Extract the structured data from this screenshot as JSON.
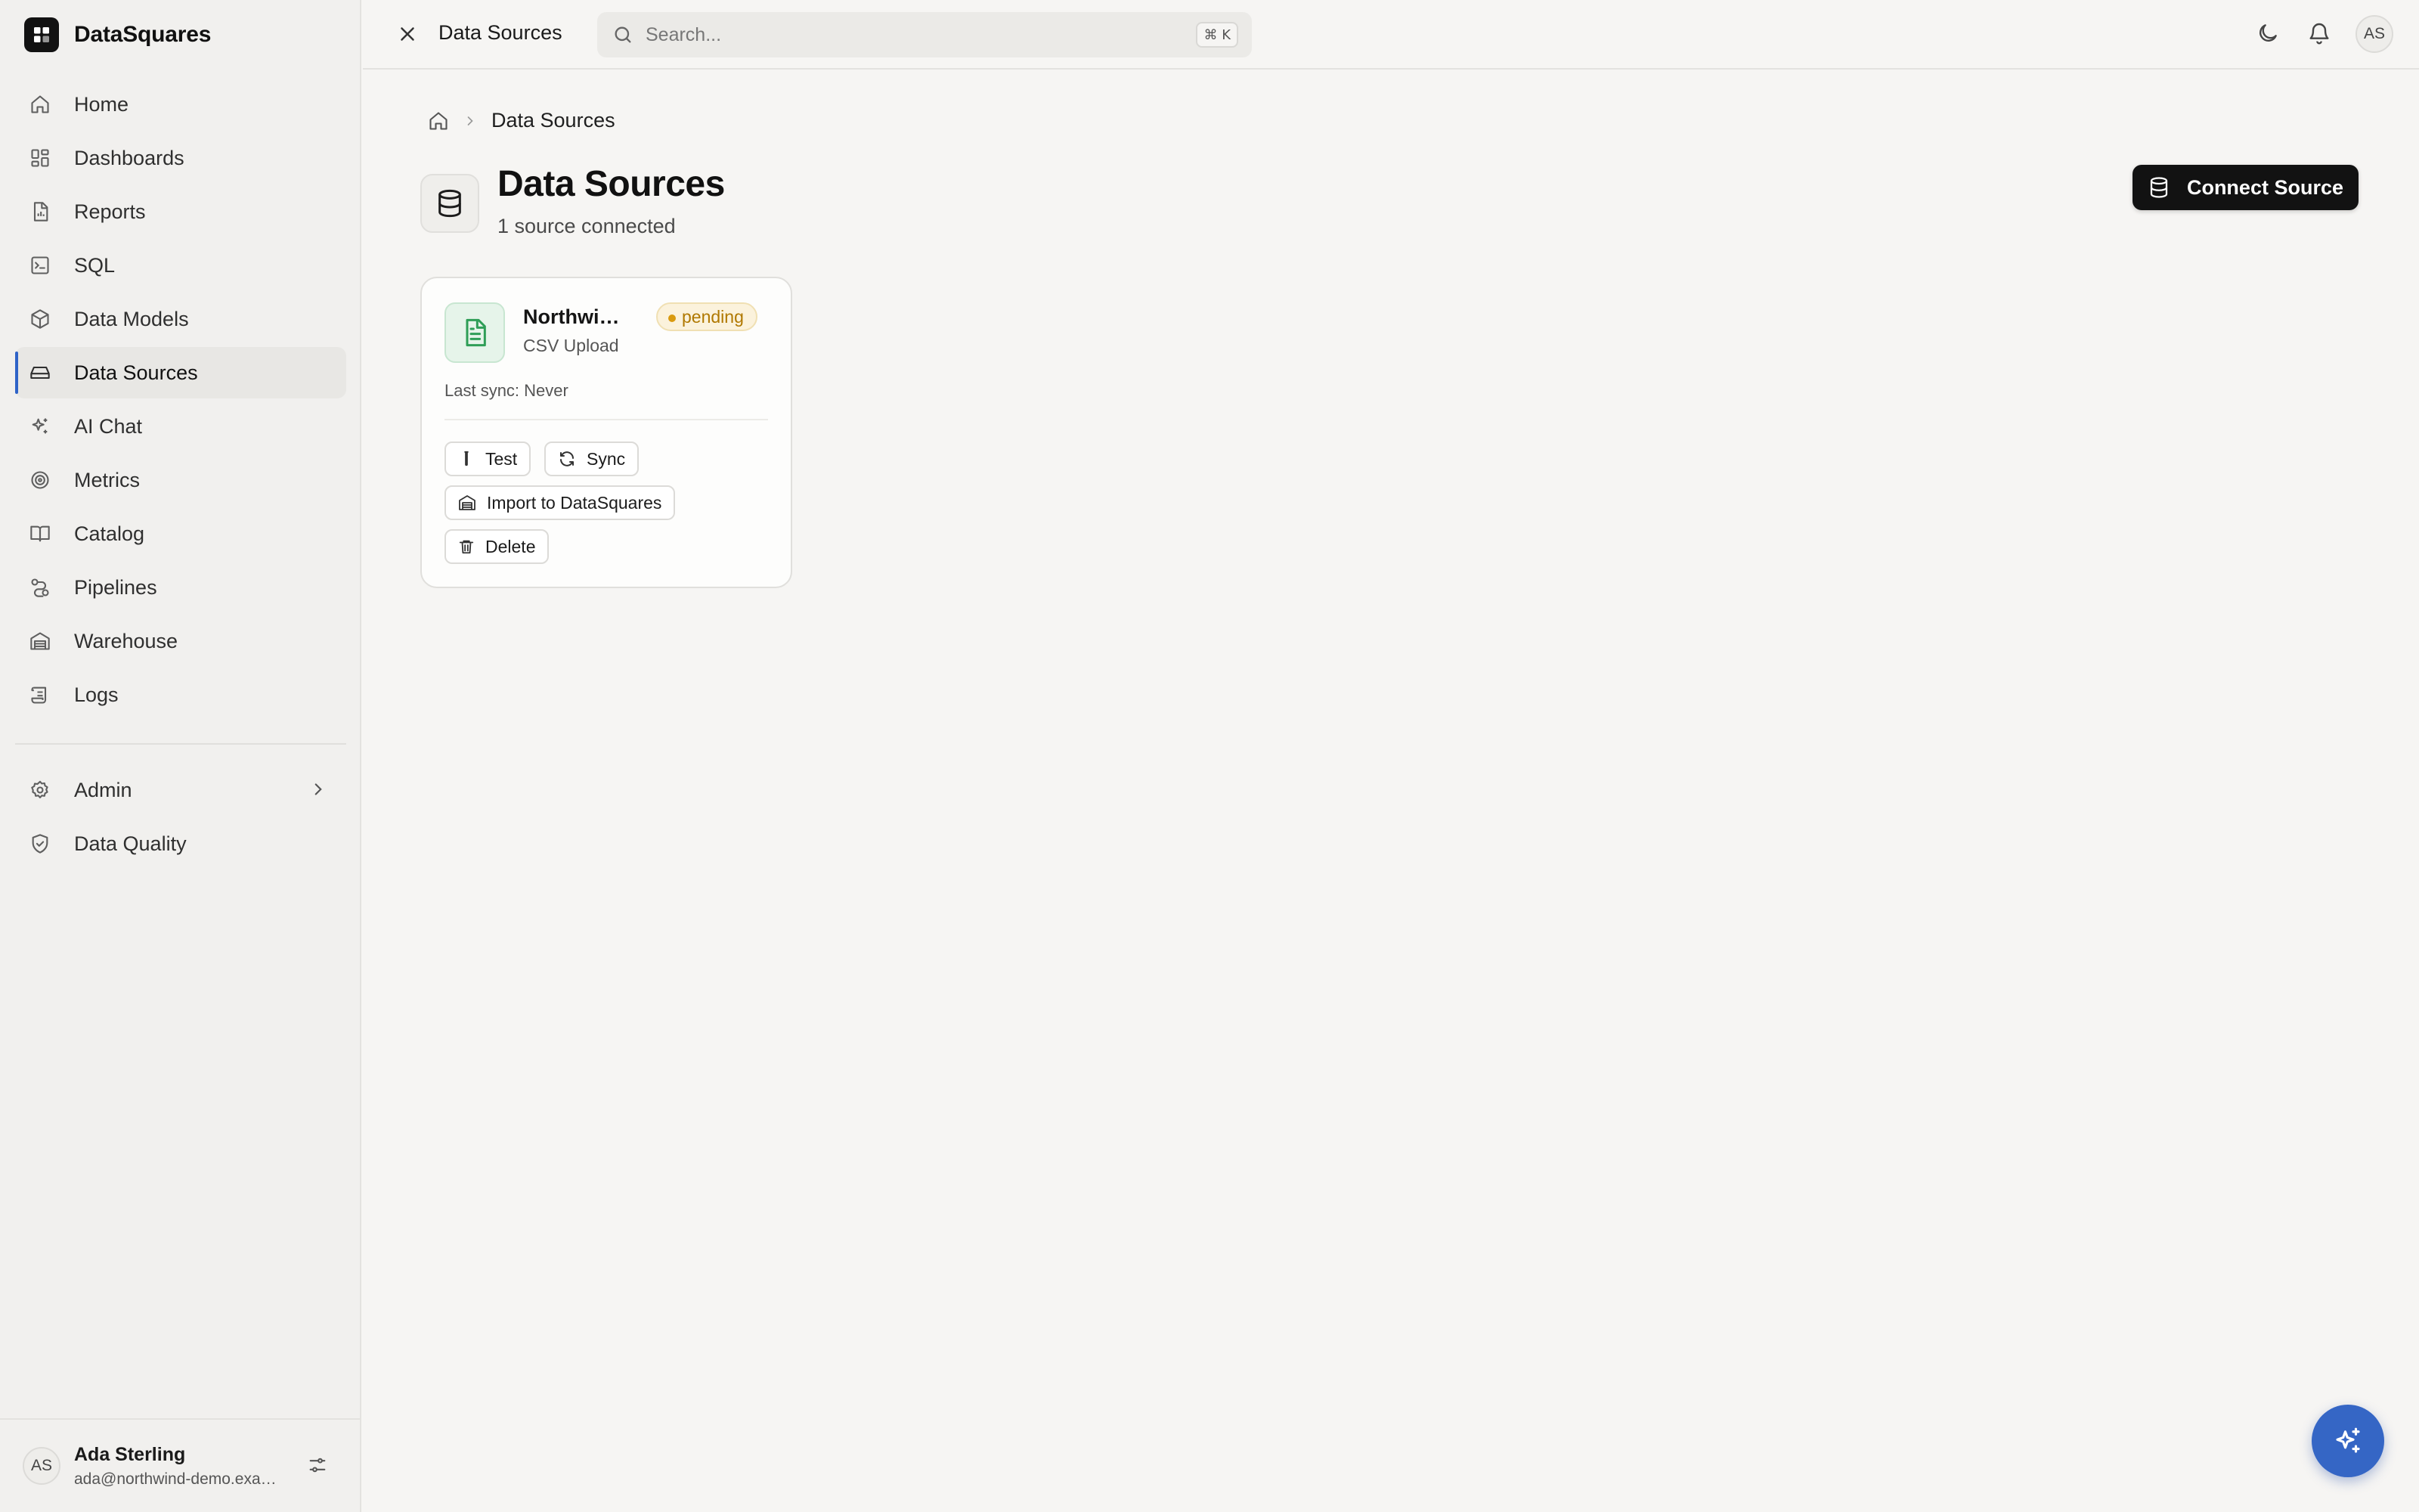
{
  "app": {
    "name": "DataSquares"
  },
  "sidebar": {
    "items": [
      {
        "label": "Home",
        "icon": "home-icon"
      },
      {
        "label": "Dashboards",
        "icon": "dashboard-icon"
      },
      {
        "label": "Reports",
        "icon": "report-icon"
      },
      {
        "label": "SQL",
        "icon": "terminal-icon"
      },
      {
        "label": "Data Models",
        "icon": "box-icon"
      },
      {
        "label": "Data Sources",
        "icon": "drive-icon",
        "active": true
      },
      {
        "label": "AI Chat",
        "icon": "sparkles-icon"
      },
      {
        "label": "Metrics",
        "icon": "target-icon"
      },
      {
        "label": "Catalog",
        "icon": "book-icon"
      },
      {
        "label": "Pipelines",
        "icon": "pipeline-icon"
      },
      {
        "label": "Warehouse",
        "icon": "warehouse-icon"
      },
      {
        "label": "Logs",
        "icon": "scroll-icon"
      }
    ],
    "secondary": [
      {
        "label": "Admin",
        "icon": "gear-icon",
        "has_chevron": true
      },
      {
        "label": "Data Quality",
        "icon": "shield-check-icon"
      }
    ],
    "user": {
      "initials": "AS",
      "name": "Ada Sterling",
      "email": "ada@northwind-demo.example.com"
    }
  },
  "topbar": {
    "title": "Data Sources",
    "search_placeholder": "Search...",
    "shortcut": "⌘ K",
    "avatar_initials": "AS"
  },
  "breadcrumb": {
    "current": "Data Sources"
  },
  "page": {
    "title": "Data Sources",
    "subtitle": "1 source connected",
    "connect_label": "Connect Source"
  },
  "sources": [
    {
      "name": "Northwind Demo",
      "type": "CSV Upload",
      "status": "pending",
      "last_sync": "Last sync: Never",
      "actions": {
        "test": "Test",
        "sync": "Sync",
        "import": "Import to DataSquares",
        "delete": "Delete"
      }
    }
  ],
  "colors": {
    "accent": "#3566c5",
    "active_indicator": "#2f63c8",
    "pending_text": "#b07800",
    "pending_bg": "#fbf2dc",
    "file_icon_green": "#2f9e57"
  }
}
